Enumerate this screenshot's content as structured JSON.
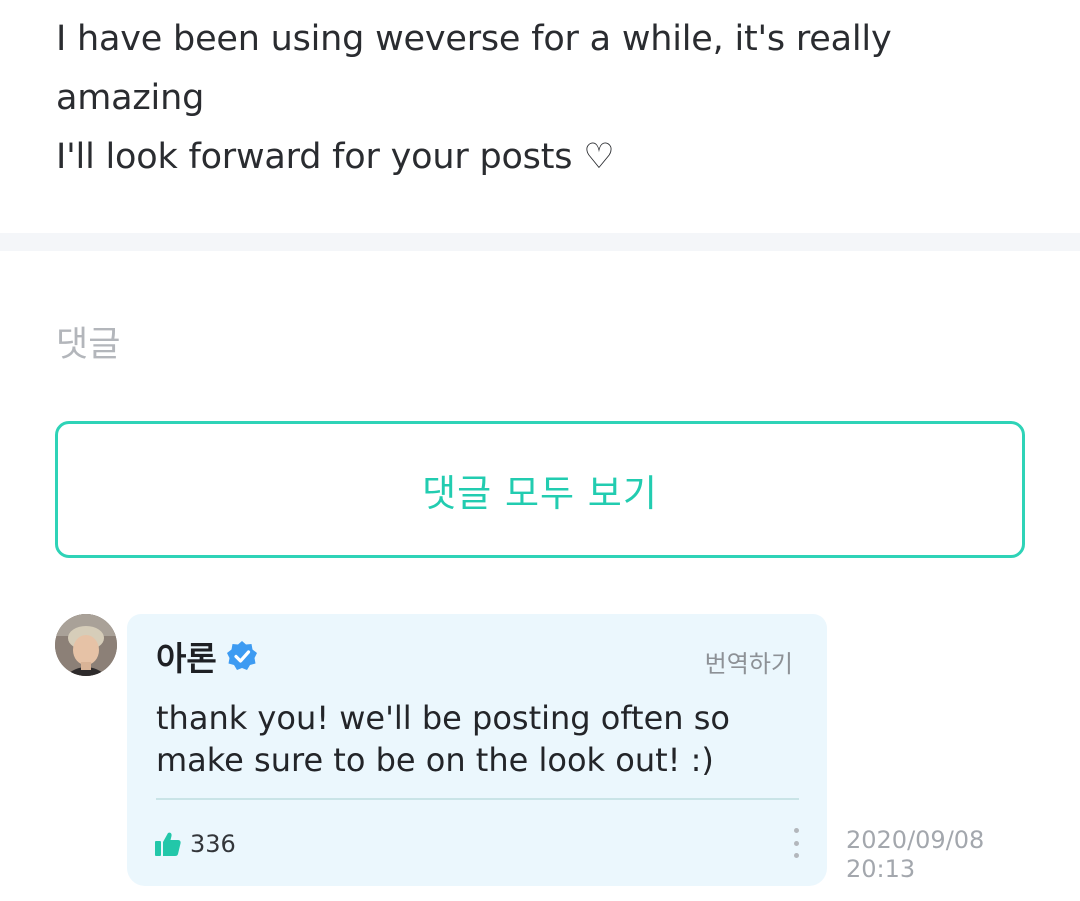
{
  "post": {
    "lines": [
      "I have been using weverse for a while, it's really",
      "amazing",
      "I'll look forward for your posts ♡"
    ]
  },
  "comments": {
    "heading": "댓글",
    "view_all_label": "댓글 모두 보기"
  },
  "reply": {
    "author": "아론",
    "translate_label": "번역하기",
    "text_lines": [
      "thank you! we'll be posting often so",
      "make sure to be on the look out! :)"
    ],
    "like_count": "336",
    "date": "2020/09/08",
    "time": "20:13"
  },
  "icons": {
    "verified": "verified-badge-icon",
    "like": "thumbs-up-icon",
    "more": "more-vertical-icon"
  },
  "colors": {
    "accent": "#2ed3b7",
    "bubble": "#ebf7fd",
    "verified": "#3d9bf2"
  }
}
